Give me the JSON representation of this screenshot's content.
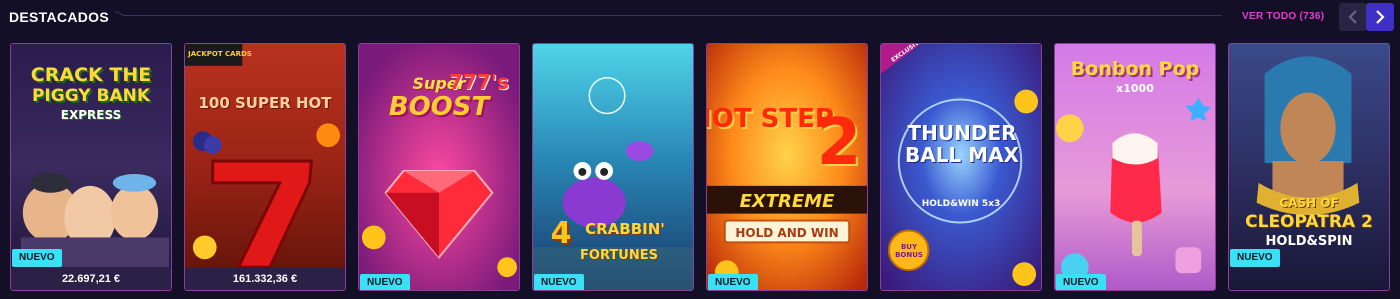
{
  "section": {
    "title": "DESTACADOS",
    "see_all": "VER TODO (736)"
  },
  "nav": {
    "prev_icon": "chevron-left-icon",
    "next_icon": "chevron-right-icon"
  },
  "colors": {
    "background": "#130f26",
    "accent_pink": "#e53fd3",
    "accent_blue": "#3f2fc7",
    "badge": "#38e2f4"
  },
  "games": [
    {
      "name_line1": "CRACK THE",
      "name_line2": "PIGGY BANK",
      "name_line3": "EXPRESS",
      "badge": "NUEVO",
      "jackpot": "22.697,21 €"
    },
    {
      "name_line1": "JACKPOT CARDS",
      "name_line2": "100 SUPER HOT",
      "name_line3": "7",
      "badge": "",
      "jackpot": "161.332,36 €"
    },
    {
      "name_line1": "Super",
      "name_line2": "777's",
      "name_line3": "BOOST",
      "badge": "NUEVO",
      "jackpot": ""
    },
    {
      "name_line1": "4",
      "name_line2": "CRABBIN'",
      "name_line3": "FORTUNES",
      "badge": "NUEVO",
      "jackpot": ""
    },
    {
      "name_line1": "HOT STEP",
      "name_line2": "2",
      "name_line3": "EXTREME",
      "name_line4": "HOLD AND WIN",
      "badge": "NUEVO",
      "jackpot": ""
    },
    {
      "name_line1": "EXCLUSIVE",
      "name_line2": "THUNDER BALL MAX",
      "name_line3": "HOLD&WIN 5x3",
      "name_line4": "BUY BONUS",
      "badge": "",
      "jackpot": ""
    },
    {
      "name_line1": "Bonbon Pop",
      "name_line2": "x1000",
      "name_line3": "",
      "badge": "NUEVO",
      "jackpot": ""
    },
    {
      "name_line1": "CASH OF",
      "name_line2": "CLEOPATRA 2",
      "name_line3": "HOLD&SPIN",
      "badge": "NUEVO",
      "jackpot": ""
    }
  ]
}
